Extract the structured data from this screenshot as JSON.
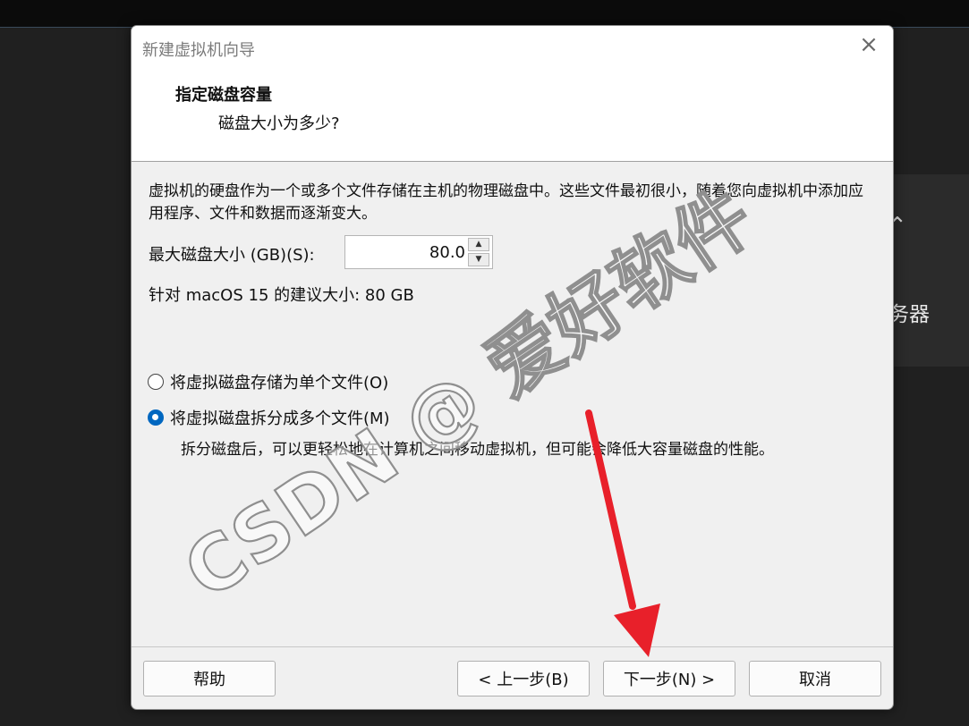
{
  "dialog": {
    "title": "新建虚拟机向导",
    "heading": "指定磁盘容量",
    "subheading": "磁盘大小为多少?",
    "description": "虚拟机的硬盘作为一个或多个文件存储在主机的物理磁盘中。这些文件最初很小，随着您向虚拟机中添加应用程序、文件和数据而逐渐变大。",
    "max_size_label": "最大磁盘大小 (GB)(S):",
    "max_size_value": "80.0",
    "recommended": "针对 macOS 15 的建议大小: 80 GB",
    "options": [
      {
        "label": "将虚拟磁盘存储为单个文件(O)",
        "checked": false
      },
      {
        "label": "将虚拟磁盘拆分成多个文件(M)",
        "checked": true
      }
    ],
    "split_description": "拆分磁盘后，可以更轻松地在计算机之间移动虚拟机，但可能会降低大容量磁盘的性能。",
    "buttons": {
      "help": "帮助",
      "back": "< 上一步(B)",
      "next": "下一步(N) >",
      "cancel": "取消"
    }
  },
  "background": {
    "partial_text": "务器"
  },
  "watermark": {
    "text": "CSDN @ 爱好软件"
  },
  "icons": {
    "close": "close-icon",
    "spin_up": "chevron-up-icon",
    "spin_down": "chevron-down-icon",
    "arrow": "red-arrow-annotation"
  },
  "colors": {
    "accent": "#0067c0",
    "arrow": "#e8202a"
  }
}
